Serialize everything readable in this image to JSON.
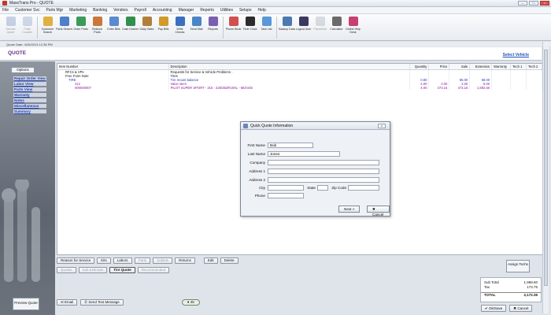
{
  "window": {
    "title": "MassTrans Pro - QUOTE"
  },
  "menu": [
    "File",
    "Customer Svc",
    "Parts Mgr",
    "Marketing",
    "Banking",
    "Vendors",
    "Payroll",
    "Accounting",
    "Manager",
    "Reports",
    "Utilities",
    "Setups",
    "Help"
  ],
  "toolbar": [
    {
      "label": "Service Quote",
      "color": "#8aa0c8",
      "dim": true
    },
    {
      "label": "Parts Counter",
      "color": "#9bb0cc",
      "dim": true
    },
    {
      "label": "Customer Search",
      "color": "#e0b040"
    },
    {
      "label": "Parts Search",
      "color": "#4f7fc9"
    },
    {
      "label": "Order Parts",
      "color": "#3c9a5b"
    },
    {
      "label": "Restock Parts",
      "color": "#c9783c"
    },
    {
      "label": "Enter Bills",
      "color": "#5a8bd1"
    },
    {
      "label": "Cash Drawer",
      "color": "#2f8f4e"
    },
    {
      "label": "Daily Sales",
      "color": "#b0803a"
    },
    {
      "label": "Pay Bills",
      "color": "#d19a2a"
    },
    {
      "label": "Write Checks",
      "color": "#3b6fbf"
    },
    {
      "label": "Send Mail",
      "color": "#4a86c5"
    },
    {
      "label": "Reports",
      "color": "#7b5fb0"
    },
    {
      "label": "Phone Book",
      "color": "#d05050"
    },
    {
      "label": "Time Clock",
      "color": "#2c2c2c"
    },
    {
      "label": "Task List",
      "color": "#5a98d8"
    },
    {
      "label": "Backup Data",
      "color": "#4a7ab0"
    },
    {
      "label": "Logout User",
      "color": "#3a3a60"
    },
    {
      "label": "PlanetDial",
      "color": "#b0b8c4",
      "dim": true
    },
    {
      "label": "Calculator",
      "color": "#6a6a6a"
    },
    {
      "label": "Online Help Desk",
      "color": "#c84070"
    }
  ],
  "doc": {
    "quote_date": "Quote Date: 4/26/2013 12:38 PM",
    "close": "×"
  },
  "header": {
    "title": "QUOTE",
    "select_vehicle": "Select Vehicle"
  },
  "left": {
    "options": "Options",
    "links": [
      "Repair Order View",
      "Labor View",
      "Parts View",
      "Warranty",
      "Notes",
      "Miscellaneous",
      "Summary"
    ],
    "preview": "Preview Quote"
  },
  "grid": {
    "columns": [
      "",
      "Item Number",
      "Description",
      "Quantity",
      "Price",
      "Sale",
      "Extension",
      "Warranty",
      "Tech 1",
      "Tech 2"
    ],
    "rows": [
      {
        "item": "RFCs & VPs",
        "desc": "Requests for Service & Vehicle Problems -",
        "qty": "",
        "price": "",
        "sale": "",
        "ext": "",
        "cls": ""
      },
      {
        "item": "Free Form Note",
        "desc": "Tires",
        "qty": "",
        "price": "",
        "sale": "",
        "ext": "",
        "cls": ""
      },
      {
        "item": "TIRE",
        "desc": "Tire mount balance",
        "qty": "0.80",
        "price": "",
        "sale": "85.00",
        "ext": "68.00",
        "cls": "blue"
      },
      {
        "item": "412",
        "desc": "Valve stem",
        "qty": "4.00",
        "price": "2.00",
        "sale": "2.00",
        "ext": "8.00",
        "cls": "purple"
      },
      {
        "item": "000000007",
        "desc": "PILOT SUPER SPORT - 315 - 225/35ZR19XL - Michelin",
        "qty": "4.00",
        "price": "473.15",
        "sale": "473.15",
        "ext": "1,892.60",
        "cls": "purple"
      }
    ]
  },
  "actions1": [
    "Reason for Service",
    "Kits",
    "Labors",
    "Parts",
    "Sublets",
    "Returns",
    "Edit",
    "Delete"
  ],
  "actions2": [
    "Quotes",
    "Sub Estimate",
    "Tire Quote",
    "Recommended"
  ],
  "assign": "Assign Techs",
  "totals": [
    {
      "label": "Sub Total",
      "value": "1,968.60"
    },
    {
      "label": "Tax",
      "value": "173.75"
    },
    {
      "label": "TOTAL",
      "value": "2,172.35"
    }
  ],
  "bottom": {
    "email": "Email",
    "send_text": "Send Text Message",
    "count": "46"
  },
  "save": {
    "ok": "Ok/Save",
    "cancel": "Cancel"
  },
  "modal": {
    "title": "Quick Quote Information",
    "first_name_label": "First Name",
    "first_name": "Bob",
    "last_name_label": "Last Name",
    "last_name": "Jones",
    "company_label": "Company",
    "company": "",
    "address1_label": "Address 1",
    "address1": "",
    "address2_label": "Address 2",
    "address2": "",
    "city_label": "City",
    "state_label": "State",
    "zip_label": "Zip Code",
    "phone_label": "Phone",
    "phone": "",
    "next": "Next >",
    "cancel": "Cancel"
  }
}
